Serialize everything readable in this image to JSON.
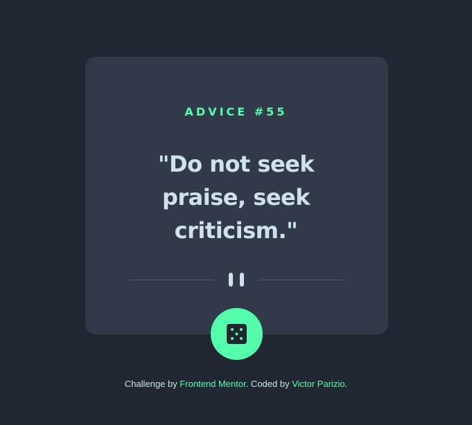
{
  "card": {
    "advice_label": "ADVICE #55",
    "quote": "\"Do not seek praise, seek criticism.\""
  },
  "divider": {
    "icon": "pause-icon"
  },
  "dice_button": {
    "icon": "dice-icon"
  },
  "footer": {
    "prefix": "Challenge by ",
    "link_one": "Frontend Mentor",
    "middle": ". Coded by ",
    "link_two": "Victor Parizio",
    "suffix": "."
  },
  "colors": {
    "background": "#202632",
    "card": "#323a49",
    "accent": "#53ffaa",
    "text": "#cee3e9",
    "divider": "#4f5d74"
  }
}
